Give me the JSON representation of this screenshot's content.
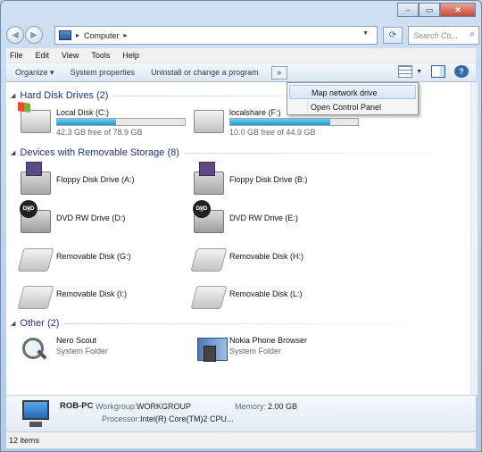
{
  "address": {
    "crumbs": [
      "Computer"
    ],
    "search_placeholder": "Search Co..."
  },
  "menubar": [
    "File",
    "Edit",
    "View",
    "Tools",
    "Help"
  ],
  "toolbar": {
    "organize": "Organize",
    "system_properties": "System properties",
    "uninstall": "Uninstall or change a program",
    "more": "»"
  },
  "overflow_menu": [
    "Map network drive",
    "Open Control Panel"
  ],
  "groups": {
    "hard_disks": "Hard Disk Drives (2)",
    "removable": "Devices with Removable Storage (8)",
    "other": "Other (2)"
  },
  "hard_disks": [
    {
      "name": "Local Disk (C:)",
      "free": "42.3 GB free of 78.9 GB",
      "used_fraction": 0.46
    },
    {
      "name": "localshare (F:)",
      "free": "10.0 GB free of 44.9 GB",
      "used_fraction": 0.78
    }
  ],
  "removable": [
    {
      "name": "Floppy Disk Drive (A:)",
      "icon": "floppy-icon"
    },
    {
      "name": "Floppy Disk Drive (B:)",
      "icon": "floppy-icon"
    },
    {
      "name": "DVD RW Drive (D:)",
      "icon": "dvd-drive-icon"
    },
    {
      "name": "DVD RW Drive (E:)",
      "icon": "dvd-drive-icon"
    },
    {
      "name": "Removable Disk (G:)",
      "icon": "removable-disk-icon"
    },
    {
      "name": "Removable Disk (H:)",
      "icon": "removable-disk-icon"
    },
    {
      "name": "Removable Disk (I:)",
      "icon": "removable-disk-icon"
    },
    {
      "name": "Removable Disk (L:)",
      "icon": "removable-disk-icon"
    }
  ],
  "other": [
    {
      "name": "Nero Scout",
      "sub": "System Folder"
    },
    {
      "name": "Nokia Phone Browser",
      "sub": "System Folder"
    }
  ],
  "details": {
    "pc_name": "ROB-PC",
    "workgroup_label": "Workgroup:",
    "workgroup": "WORKGROUP",
    "memory_label": "Memory:",
    "memory": "2.00 GB",
    "processor_label": "Processor:",
    "processor": "Intel(R) Core(TM)2 CPU..."
  },
  "status": "12 items"
}
